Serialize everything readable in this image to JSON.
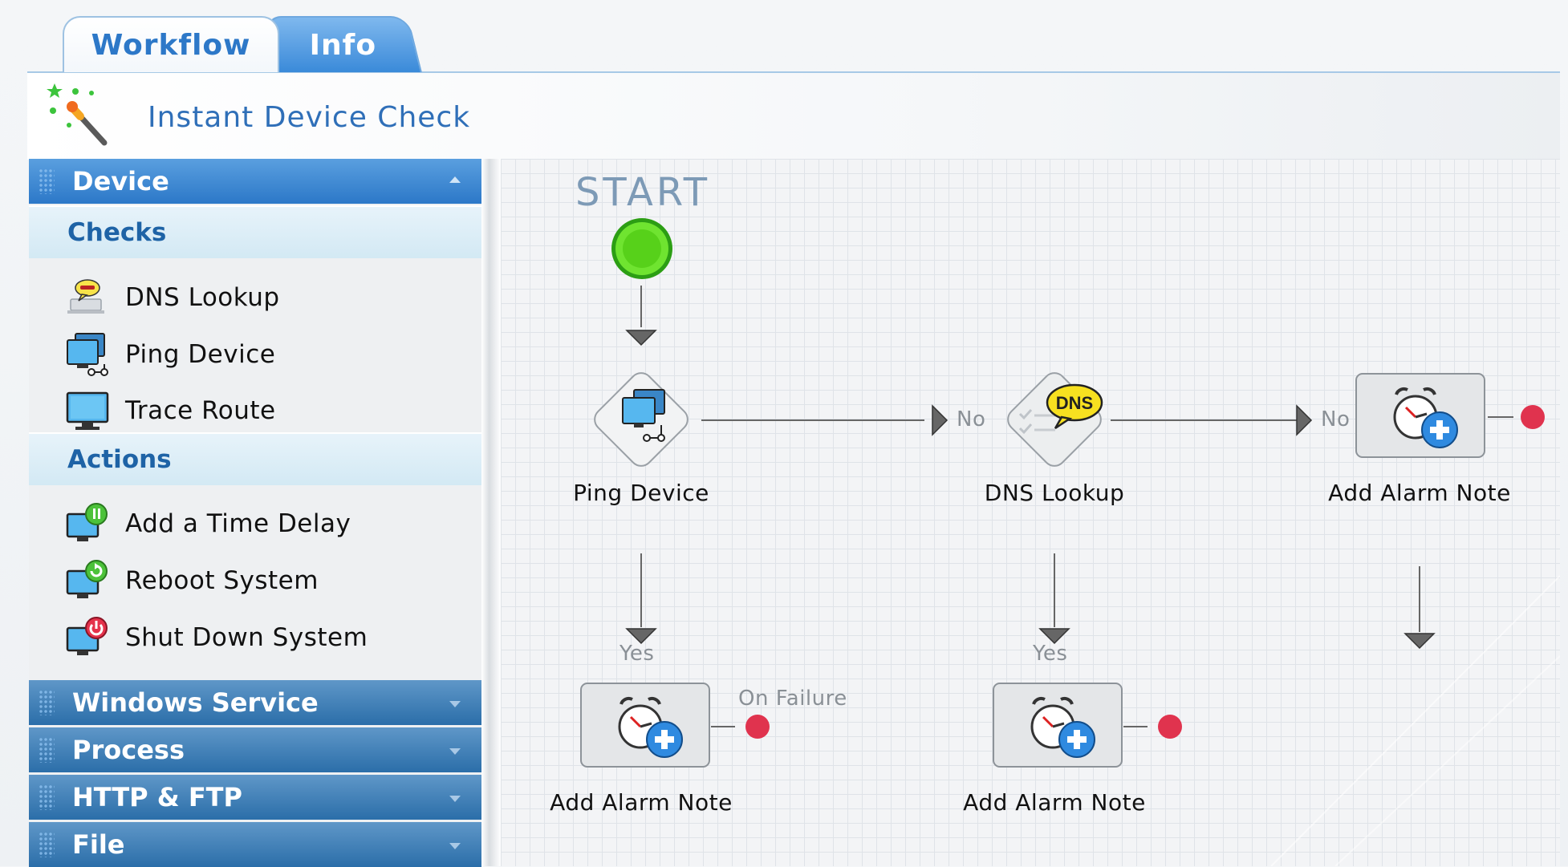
{
  "tabs": [
    {
      "label": "Workflow",
      "active": true
    },
    {
      "label": "Info",
      "active": false
    }
  ],
  "header": {
    "title": "Instant Device Check",
    "icon": "magic-wand-icon"
  },
  "sidebar": {
    "device_section": {
      "label": "Device",
      "expanded": true
    },
    "checks": {
      "label": "Checks",
      "items": [
        {
          "label": "DNS Lookup",
          "icon": "dns-lookup-icon"
        },
        {
          "label": "Ping Device",
          "icon": "ping-device-icon"
        },
        {
          "label": "Trace Route",
          "icon": "trace-route-icon"
        }
      ]
    },
    "actions": {
      "label": "Actions",
      "items": [
        {
          "label": "Add a Time Delay",
          "icon": "time-delay-icon"
        },
        {
          "label": "Reboot System",
          "icon": "reboot-icon"
        },
        {
          "label": "Shut Down System",
          "icon": "shutdown-icon"
        }
      ]
    },
    "collapsed_sections": [
      {
        "label": "Windows Service"
      },
      {
        "label": "Process"
      },
      {
        "label": "HTTP & FTP"
      },
      {
        "label": "File"
      }
    ]
  },
  "workflow": {
    "start_label": "START",
    "nodes": {
      "ping": {
        "label": "Ping Device"
      },
      "dns": {
        "label": "DNS Lookup",
        "badge": "DNS"
      },
      "alarm_top_right": {
        "label": "Add Alarm Note"
      },
      "alarm_ping_yes": {
        "label": "Add Alarm Note"
      },
      "alarm_dns_yes": {
        "label": "Add Alarm Note"
      }
    },
    "edges": {
      "no_label": "No",
      "yes_label": "Yes",
      "on_failure_label": "On Failure"
    },
    "colors": {
      "start": "#57d11a",
      "failure_dot": "#e0334e",
      "accent": "#2c78c8"
    }
  }
}
